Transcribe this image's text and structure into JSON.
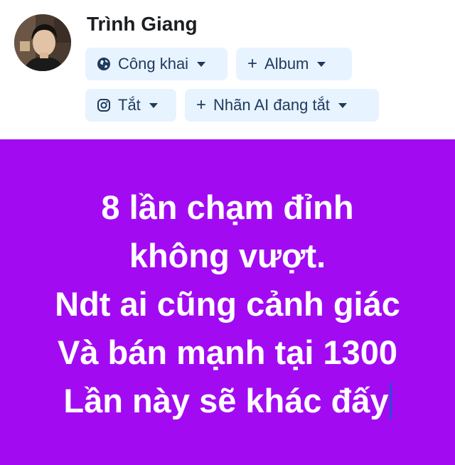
{
  "author": {
    "name": "Trình Giang"
  },
  "controls": {
    "privacy": {
      "label": "Công khai",
      "icon": "globe-icon"
    },
    "album": {
      "label": "Album",
      "icon": "plus-icon"
    },
    "instagram": {
      "label": "Tắt",
      "icon": "instagram-icon"
    },
    "ai_label": {
      "label": "Nhãn AI đang tắt",
      "icon": "plus-icon"
    }
  },
  "post": {
    "background_color": "#a20bf2",
    "text_color": "#ffffff",
    "lines": [
      "8 lần chạm đỉnh",
      "không vượt.",
      "Ndt ai cũng cảnh giác",
      "Và bán mạnh tại 1300",
      "Lần này sẽ khác đấy"
    ]
  },
  "colors": {
    "chip_background": "#e7f3ff",
    "chip_text": "#1f3a5c",
    "cursor": "#2d4ad6"
  }
}
